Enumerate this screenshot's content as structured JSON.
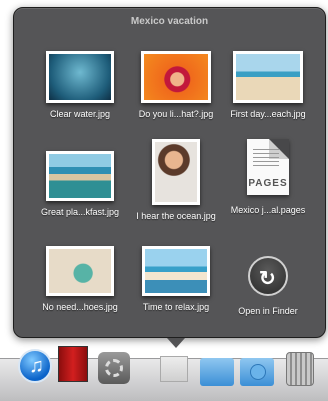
{
  "stack": {
    "title": "Mexico vacation",
    "items": [
      {
        "label": "Clear water.jpg",
        "icon": "photo-thumbnail"
      },
      {
        "label": "Do you li...hat?.jpg",
        "icon": "photo-thumbnail"
      },
      {
        "label": "First day...each.jpg",
        "icon": "photo-thumbnail"
      },
      {
        "label": "Great pla...kfast.jpg",
        "icon": "photo-thumbnail"
      },
      {
        "label": "I hear the ocean.jpg",
        "icon": "photo-thumbnail"
      },
      {
        "label": "Mexico j...al.pages",
        "icon": "pages-document"
      },
      {
        "label": "No need...hoes.jpg",
        "icon": "photo-thumbnail"
      },
      {
        "label": "Time to relax.jpg",
        "icon": "photo-thumbnail"
      },
      {
        "label": "Open in Finder",
        "icon": "open-in-finder-icon"
      }
    ],
    "doc_badge": "PAGES"
  },
  "dock": {
    "icons": [
      "itunes-icon",
      "front-row-icon",
      "system-preferences-icon",
      "stack-icon",
      "folder-icon",
      "downloads-folder-icon",
      "trash-icon"
    ]
  },
  "colors": {
    "stack_bg": "#48484a",
    "label_text": "#ffffff",
    "title_text": "#c9c9c9"
  }
}
